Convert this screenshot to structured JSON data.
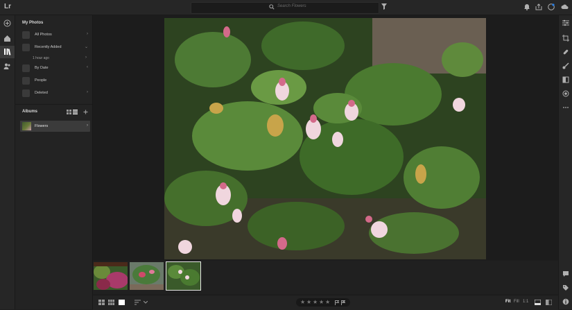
{
  "app": {
    "logo": "Lr"
  },
  "search": {
    "placeholder": "Search Flowers"
  },
  "sidebar": {
    "my_photos_title": "My Photos",
    "items": [
      {
        "label": "All Photos",
        "chevron": "›"
      },
      {
        "label": "Recently Added",
        "chevron": "⌄"
      },
      {
        "label": "By Date",
        "chevron": "‹"
      },
      {
        "label": "People",
        "chevron": ""
      },
      {
        "label": "Deleted",
        "chevron": "›"
      }
    ],
    "recent_sub": {
      "label": "1 hour ago",
      "chevron": "›"
    },
    "albums_title": "Albums",
    "albums": [
      {
        "label": "Flowers",
        "chevron": "›"
      }
    ]
  },
  "bottombar": {
    "stars": [
      "★",
      "★",
      "★",
      "★",
      "★"
    ],
    "zoom": {
      "fit": "Fit",
      "fill": "Fill",
      "one": "1:1"
    }
  },
  "filmstrip": {
    "thumbnails": 3,
    "selected": 3
  },
  "colors": {
    "accent": "#2680eb",
    "panel": "#232323",
    "selected_item": "#3b3b3b"
  },
  "icons": {
    "top": [
      "search-icon",
      "filter-icon",
      "notification-icon",
      "share-icon",
      "help-icon",
      "avatar-icon",
      "cloud-icon"
    ],
    "left": [
      "add-photos-icon",
      "home-icon",
      "library-icon",
      "people-icon"
    ],
    "right": [
      "edit-sliders-icon",
      "crop-icon",
      "healing-icon",
      "brush-icon",
      "linear-gradient-icon",
      "radial-icon",
      "more-icon",
      "comments-icon",
      "tags-icon",
      "info-icon"
    ]
  }
}
